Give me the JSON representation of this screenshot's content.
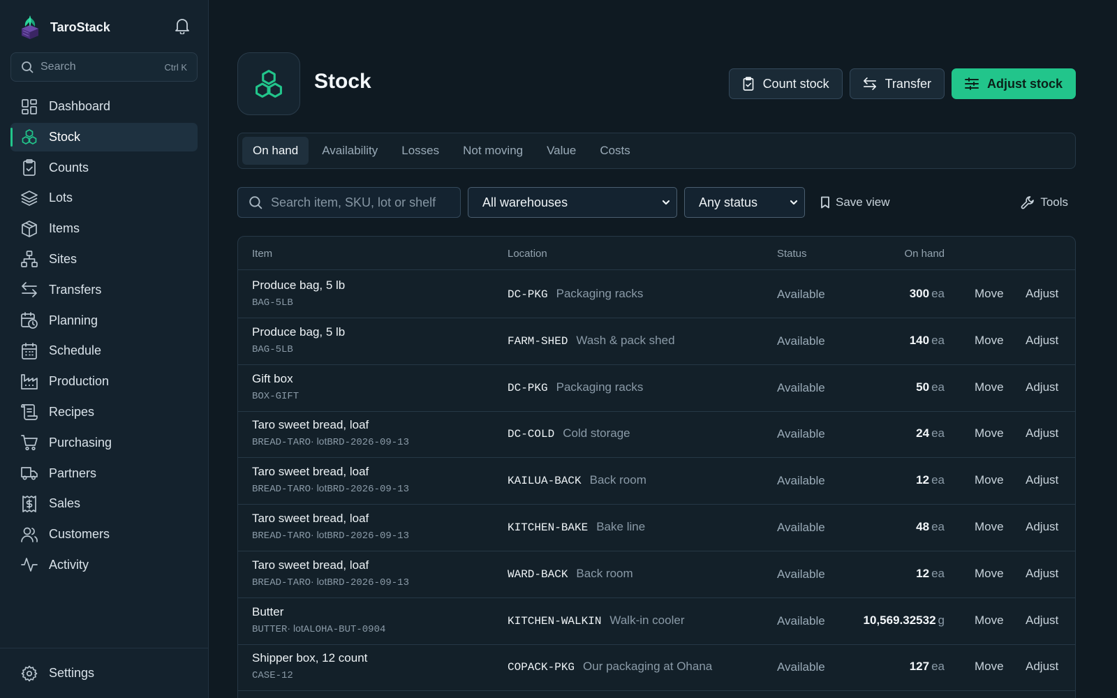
{
  "app": {
    "name": "TaroStack"
  },
  "sidebar": {
    "search": {
      "placeholder": "Search",
      "shortcut": "Ctrl K"
    },
    "items": [
      {
        "label": "Dashboard",
        "icon": "dashboard-icon"
      },
      {
        "label": "Stock",
        "icon": "stock-icon",
        "active": true
      },
      {
        "label": "Counts",
        "icon": "clipboard-check-icon"
      },
      {
        "label": "Lots",
        "icon": "layers-icon"
      },
      {
        "label": "Items",
        "icon": "box-icon"
      },
      {
        "label": "Sites",
        "icon": "sites-icon"
      },
      {
        "label": "Transfers",
        "icon": "transfer-icon"
      },
      {
        "label": "Planning",
        "icon": "calendar-clock-icon"
      },
      {
        "label": "Schedule",
        "icon": "calendar-icon"
      },
      {
        "label": "Production",
        "icon": "factory-icon"
      },
      {
        "label": "Recipes",
        "icon": "recipe-icon"
      },
      {
        "label": "Purchasing",
        "icon": "cart-icon"
      },
      {
        "label": "Partners",
        "icon": "truck-icon"
      },
      {
        "label": "Sales",
        "icon": "receipt-dollar-icon"
      },
      {
        "label": "Customers",
        "icon": "users-icon"
      },
      {
        "label": "Activity",
        "icon": "activity-icon"
      }
    ],
    "settings": {
      "label": "Settings",
      "icon": "gear-icon"
    }
  },
  "header": {
    "title": "Stock",
    "actions": {
      "count_stock": "Count stock",
      "transfer": "Transfer",
      "adjust_stock": "Adjust stock"
    }
  },
  "tabs": [
    {
      "label": "On hand",
      "active": true
    },
    {
      "label": "Availability"
    },
    {
      "label": "Losses"
    },
    {
      "label": "Not moving"
    },
    {
      "label": "Value"
    },
    {
      "label": "Costs"
    }
  ],
  "filters": {
    "search_placeholder": "Search item, SKU, lot or shelf",
    "warehouse": "All warehouses",
    "status": "Any status",
    "save_view": "Save view",
    "tools": "Tools"
  },
  "table": {
    "columns": {
      "item": "Item",
      "location": "Location",
      "status": "Status",
      "on_hand": "On hand"
    },
    "rows": [
      {
        "name": "Produce bag, 5 lb",
        "sku": "BAG-5LB",
        "lot": "",
        "loc_code": "DC-PKG",
        "loc_name": "Packaging racks",
        "status": "Available",
        "qty": "300",
        "unit": "ea",
        "move": "Move",
        "adjust": "Adjust"
      },
      {
        "name": "Produce bag, 5 lb",
        "sku": "BAG-5LB",
        "lot": "",
        "loc_code": "FARM-SHED",
        "loc_name": "Wash & pack shed",
        "status": "Available",
        "qty": "140",
        "unit": "ea",
        "move": "Move",
        "adjust": "Adjust"
      },
      {
        "name": "Gift box",
        "sku": "BOX-GIFT",
        "lot": "",
        "loc_code": "DC-PKG",
        "loc_name": "Packaging racks",
        "status": "Available",
        "qty": "50",
        "unit": "ea",
        "move": "Move",
        "adjust": "Adjust"
      },
      {
        "name": "Taro sweet bread, loaf",
        "sku": "BREAD-TARO",
        "lot": "· lot",
        "lot_code": "BRD-2026-09-13",
        "loc_code": "DC-COLD",
        "loc_name": "Cold storage",
        "status": "Available",
        "qty": "24",
        "unit": "ea",
        "move": "Move",
        "adjust": "Adjust"
      },
      {
        "name": "Taro sweet bread, loaf",
        "sku": "BREAD-TARO",
        "lot": "· lot",
        "lot_code": "BRD-2026-09-13",
        "loc_code": "KAILUA-BACK",
        "loc_name": "Back room",
        "status": "Available",
        "qty": "12",
        "unit": "ea",
        "move": "Move",
        "adjust": "Adjust"
      },
      {
        "name": "Taro sweet bread, loaf",
        "sku": "BREAD-TARO",
        "lot": "· lot",
        "lot_code": "BRD-2026-09-13",
        "loc_code": "KITCHEN-BAKE",
        "loc_name": "Bake line",
        "status": "Available",
        "qty": "48",
        "unit": "ea",
        "move": "Move",
        "adjust": "Adjust"
      },
      {
        "name": "Taro sweet bread, loaf",
        "sku": "BREAD-TARO",
        "lot": "· lot",
        "lot_code": "BRD-2026-09-13",
        "loc_code": "WARD-BACK",
        "loc_name": "Back room",
        "status": "Available",
        "qty": "12",
        "unit": "ea",
        "move": "Move",
        "adjust": "Adjust"
      },
      {
        "name": "Butter",
        "sku": "BUTTER",
        "lot": "· lot",
        "lot_code": "ALOHA-BUT-0904",
        "loc_code": "KITCHEN-WALKIN",
        "loc_name": "Walk-in cooler",
        "status": "Available",
        "qty": "10,569.32532",
        "unit": "g",
        "move": "Move",
        "adjust": "Adjust"
      },
      {
        "name": "Shipper box, 12 count",
        "sku": "CASE-12",
        "lot": "",
        "loc_code": "COPACK-PKG",
        "loc_name": "Our packaging at Ohana",
        "status": "Available",
        "qty": "127",
        "unit": "ea",
        "move": "Move",
        "adjust": "Adjust"
      }
    ]
  },
  "colors": {
    "accent": "#22c58b",
    "background": "#0f1a22",
    "sidebar": "#14222d"
  }
}
